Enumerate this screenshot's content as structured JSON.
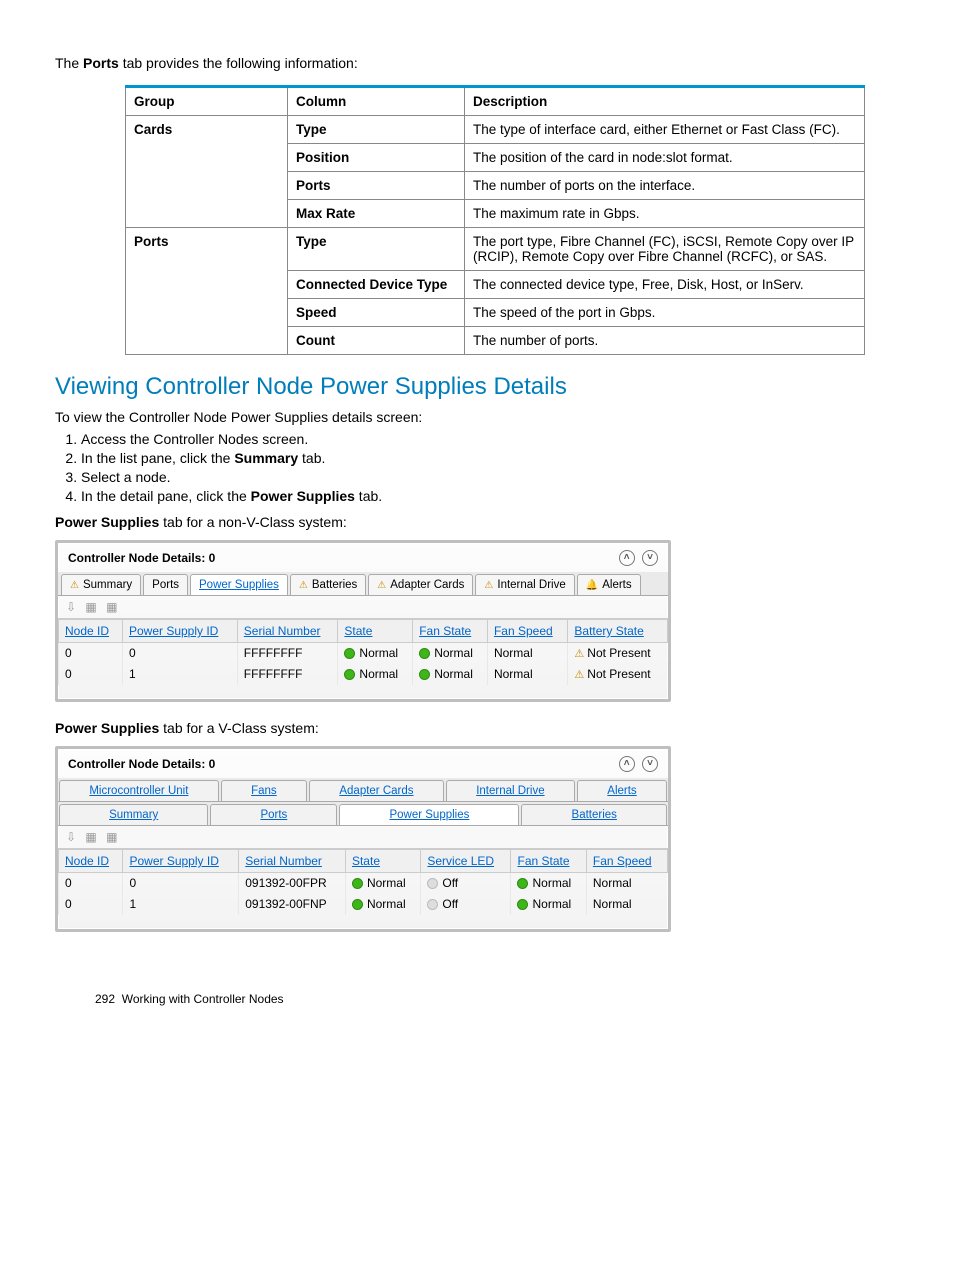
{
  "intro_pre": "The ",
  "intro_bold": "Ports",
  "intro_post": " tab provides the following information:",
  "table1": {
    "headers": [
      "Group",
      "Column",
      "Description"
    ],
    "rows": [
      [
        "Cards",
        "Type",
        "The type of interface card, either Ethernet or Fast Class (FC)."
      ],
      [
        "",
        "Position",
        "The position of the card in node:slot format."
      ],
      [
        "",
        "Ports",
        "The number of ports on the interface."
      ],
      [
        "",
        "Max Rate",
        "The maximum rate in Gbps."
      ],
      [
        "Ports",
        "Type",
        "The port type, Fibre Channel (FC), iSCSI, Remote Copy over IP (RCIP), Remote Copy over Fibre Channel (RCFC), or SAS."
      ],
      [
        "",
        "Connected Device Type",
        "The connected device type, Free, Disk, Host, or InServ."
      ],
      [
        "",
        "Speed",
        "The speed of the port in Gbps."
      ],
      [
        "",
        "Count",
        "The number of ports."
      ]
    ]
  },
  "heading": "Viewing Controller Node Power Supplies Details",
  "para1": "To view the Controller Node Power Supplies details screen:",
  "steps": [
    "Access the Controller Nodes screen.",
    {
      "pre": "In the list pane, click the ",
      "b": "Summary",
      "post": " tab."
    },
    "Select a node.",
    {
      "pre": "In the detail pane, click the ",
      "b": "Power Supplies",
      "post": " tab."
    }
  ],
  "caption1_b": "Power Supplies",
  "caption1_rest": " tab for a non-V-Class system:",
  "ss1": {
    "title": "Controller Node Details: 0",
    "tabs": [
      "Summary",
      "Ports",
      "Power Supplies",
      "Batteries",
      "Adapter Cards",
      "Internal Drive",
      "Alerts"
    ],
    "columns": [
      "Node ID",
      "Power Supply ID",
      "Serial Number",
      "State",
      "Fan State",
      "Fan Speed",
      "Battery State"
    ],
    "rows": [
      {
        "node": "0",
        "ps": "0",
        "sn": "FFFFFFFF",
        "state": "Normal",
        "fanstate": "Normal",
        "fanspeed": "Normal",
        "batt": "Not Present"
      },
      {
        "node": "0",
        "ps": "1",
        "sn": "FFFFFFFF",
        "state": "Normal",
        "fanstate": "Normal",
        "fanspeed": "Normal",
        "batt": "Not Present"
      }
    ]
  },
  "caption2_b": "Power Supplies",
  "caption2_rest": " tab for a V-Class system:",
  "ss2": {
    "title": "Controller Node Details: 0",
    "tabs_row1": [
      "Microcontroller Unit",
      "Fans",
      "Adapter Cards",
      "Internal Drive",
      "Alerts"
    ],
    "tabs_row2": [
      "Summary",
      "Ports",
      "Power Supplies",
      "Batteries"
    ],
    "columns": [
      "Node ID",
      "Power Supply ID",
      "Serial Number",
      "State",
      "Service LED",
      "Fan State",
      "Fan Speed"
    ],
    "rows": [
      {
        "node": "0",
        "ps": "0",
        "sn": "091392-00FPR",
        "state": "Normal",
        "led": "Off",
        "fanstate": "Normal",
        "fanspeed": "Normal"
      },
      {
        "node": "0",
        "ps": "1",
        "sn": "091392-00FNP",
        "state": "Normal",
        "led": "Off",
        "fanstate": "Normal",
        "fanspeed": "Normal"
      }
    ]
  },
  "footer_page": "292",
  "footer_text": "Working with Controller Nodes"
}
